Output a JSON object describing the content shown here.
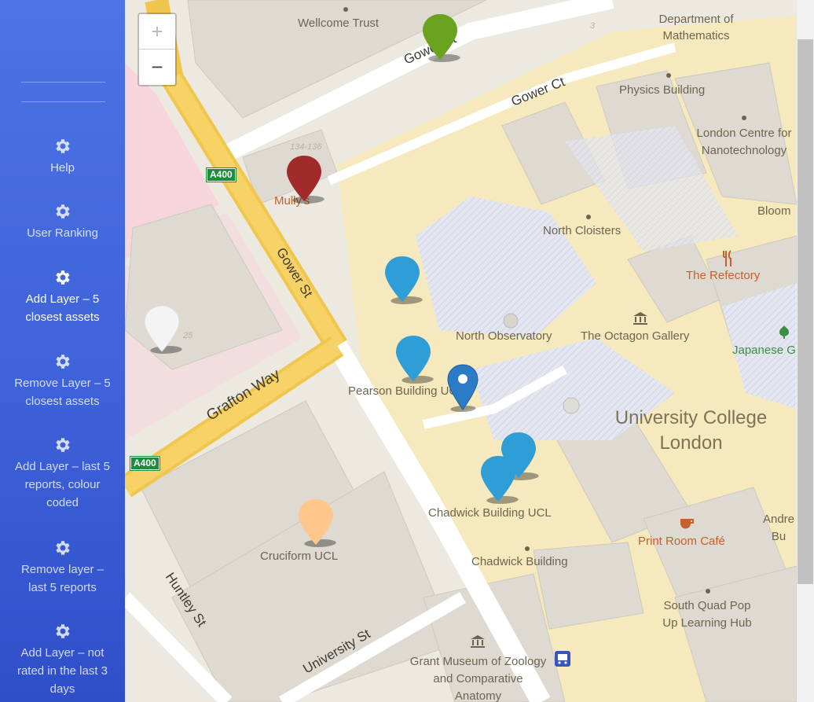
{
  "sidebar": {
    "items": [
      {
        "label": "Help"
      },
      {
        "label": "User Ranking"
      },
      {
        "label": "Add Layer – 5 closest assets"
      },
      {
        "label": "Remove Layer – 5 closest assets"
      },
      {
        "label": "Add Layer – last 5 reports, colour coded"
      },
      {
        "label": "Remove layer – last 5 reports"
      },
      {
        "label": "Add Layer – not rated in the last 3 days"
      }
    ]
  },
  "map": {
    "zoom_in": "+",
    "zoom_out": "−",
    "labels": {
      "wellcome": "Wellcome Trust",
      "dept_math": "Department of Mathematics",
      "physics": "Physics Building",
      "london_centre": "London Centre for Nanotechnology",
      "bloom": "Bloom",
      "north_cloisters": "North Cloisters",
      "refectory": "The Refectory",
      "north_obs": "North Observatory",
      "octagon": "The Octagon Gallery",
      "japanese": "Japanese G",
      "ucl": "University College London",
      "pearson": "Pearson Building UCL",
      "chadwick_ucl": "Chadwick Building UCL",
      "chadwick": "Chadwick Building",
      "print_room": "Print Room Café",
      "andre": "Andre Bu",
      "south_quad": "South Quad Pop Up Learning Hub",
      "grant": "Grant Museum of Zoology and Comparative Anatomy",
      "cruciform": "Cruciform UCL",
      "mullys": "Mully's",
      "num_134": "134-136",
      "num_3": "3",
      "num_25": "25"
    },
    "roads": {
      "gower_st": "Gower St",
      "gower_ct": "Gower Ct",
      "gower_top": "Gower St",
      "grafton": "Grafton Way",
      "university": "University St",
      "huntley": "Huntley St",
      "a400_1": "A400",
      "a400_2": "A400"
    },
    "markers": [
      {
        "name": "green",
        "color": "#6aa320"
      },
      {
        "name": "red",
        "color": "#a12a2b"
      },
      {
        "name": "white",
        "color": "#f4f4f4"
      },
      {
        "name": "blue1",
        "color": "#2f9ed6"
      },
      {
        "name": "blue2",
        "color": "#2f9ed6"
      },
      {
        "name": "location",
        "color": "#2a7cc7"
      },
      {
        "name": "blue3",
        "color": "#2f9ed6"
      },
      {
        "name": "blue4",
        "color": "#2f9ed6"
      },
      {
        "name": "orange",
        "color": "#ffc78c"
      }
    ]
  }
}
